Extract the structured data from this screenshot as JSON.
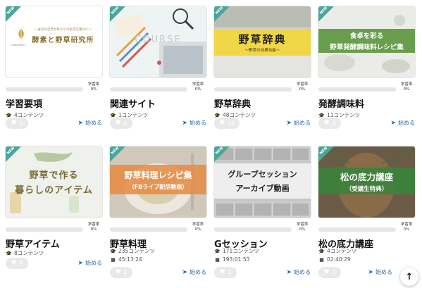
{
  "new_badge": "NEW",
  "progress_label_line1": "学習率",
  "start_label": "始める",
  "colors": {
    "accent_teal": "#4aa69a",
    "link_blue": "#2d6aa6",
    "progress_fill": "#5bb0a3"
  },
  "cards": [
    {
      "title": "学習要項",
      "progress_percent": "0%",
      "progress_value": 0,
      "contents": "4コンテンツ",
      "duration": "",
      "likes": "3",
      "thumb_texts": {
        "line1": "～身近な自然が私たちの生活を豊かに～",
        "line2": "酵素と野草研究所",
        "logo": "Laboratory"
      }
    },
    {
      "title": "関連サイト",
      "progress_percent": "0%",
      "progress_value": 0,
      "contents": "1コンテンツ",
      "duration": "",
      "likes": "4",
      "thumb_texts": {
        "line1": "COURSE"
      }
    },
    {
      "title": "野草辞典",
      "progress_percent": "0%",
      "progress_value": 0,
      "contents": "48コンテンツ",
      "duration": "",
      "likes": "10",
      "thumb_texts": {
        "line1": "野草辞典",
        "line2": "～野草の効果効能～"
      }
    },
    {
      "title": "発酵調味料",
      "progress_percent": "0%",
      "progress_value": 0,
      "contents": "11コンテンツ",
      "duration": "",
      "likes": "8",
      "thumb_texts": {
        "line1": "食卓を彩る",
        "line2": "野草発酵調味料レシピ集"
      }
    },
    {
      "title": "野草アイテム",
      "progress_percent": "0%",
      "progress_value": 0,
      "contents": "8コンテンツ",
      "duration": "",
      "likes": "8",
      "thumb_texts": {
        "line1": "野草で作る",
        "line2": "暮らしのアイテム"
      }
    },
    {
      "title": "野草料理",
      "progress_percent": "0%",
      "progress_value": 0,
      "contents": "235コンテンツ",
      "duration": "45:13:24",
      "likes": "4",
      "thumb_texts": {
        "line1": "野草料理レシピ集",
        "line2": "（FBライブ配信動画）"
      }
    },
    {
      "title": "Gセッション",
      "progress_percent": "0%",
      "progress_value": 0,
      "contents": "171コンテンツ",
      "duration": "193:01:53",
      "likes": "4",
      "thumb_texts": {
        "line1": "グループセッション",
        "line2": "アーカイブ動画"
      }
    },
    {
      "title": "松の底力講座",
      "progress_percent": "0%",
      "progress_value": 0,
      "contents": "4コンテンツ",
      "duration": "02:40:29",
      "likes": "7",
      "thumb_texts": {
        "line1": "松の底力講座",
        "line2": "（受講生特典）"
      }
    }
  ]
}
